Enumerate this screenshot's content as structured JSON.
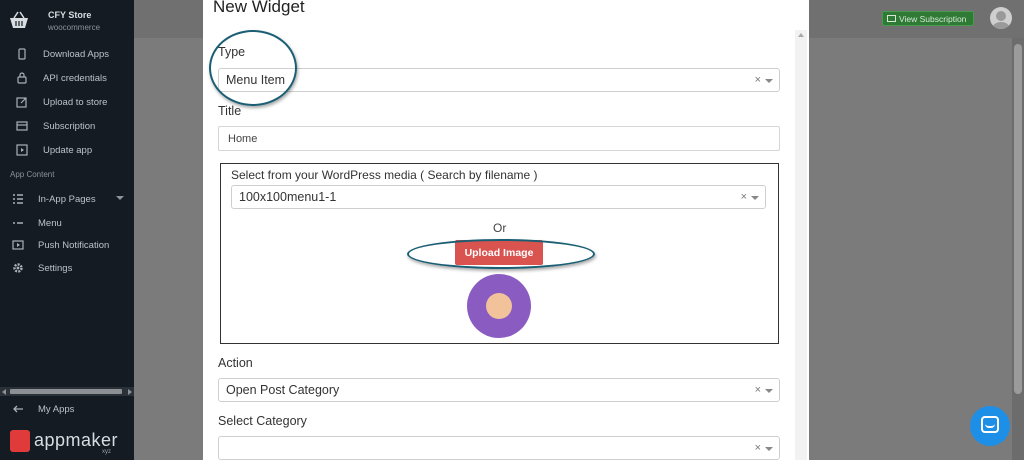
{
  "sidebar": {
    "store_name": "CFY Store",
    "store_platform": "woocommerce",
    "items": [
      {
        "label": "Download Apps",
        "icon": "phone-icon"
      },
      {
        "label": "API credentials",
        "icon": "lock-icon"
      },
      {
        "label": "Upload to store",
        "icon": "edit-icon"
      },
      {
        "label": "Subscription",
        "icon": "card-icon"
      },
      {
        "label": "Update app",
        "icon": "play-icon"
      }
    ],
    "section_label": "App Content",
    "content_items": [
      {
        "label": "In-App Pages",
        "icon": "grid-icon"
      },
      {
        "label": "Menu",
        "icon": "menu-icon"
      },
      {
        "label": "Push Notification",
        "icon": "play-box-icon"
      },
      {
        "label": "Settings",
        "icon": "gear-icon"
      }
    ],
    "my_apps_label": "My Apps",
    "brand_name": "appmaker",
    "brand_suffix": "xyz"
  },
  "topbar": {
    "view_subscription_label": "View Subscription"
  },
  "modal": {
    "title": "New Widget",
    "type_label": "Type",
    "type_value": "Menu Item",
    "title_label": "Title",
    "title_value": "Home",
    "media_label": "Select from your WordPress media ( Search by filename )",
    "media_value": "100x100menu1-1",
    "or_text": "Or",
    "upload_label": "Upload Image",
    "action_label": "Action",
    "action_value": "Open Post Category",
    "category_label": "Select Category",
    "category_value": "",
    "clear_symbol": "×"
  },
  "colors": {
    "sidebar_bg": "#141b22",
    "upload_button": "#d9534f",
    "subscription_button": "#2f7a35",
    "highlight_ring": "#1a5e73",
    "chat_button": "#1e8fe6"
  }
}
